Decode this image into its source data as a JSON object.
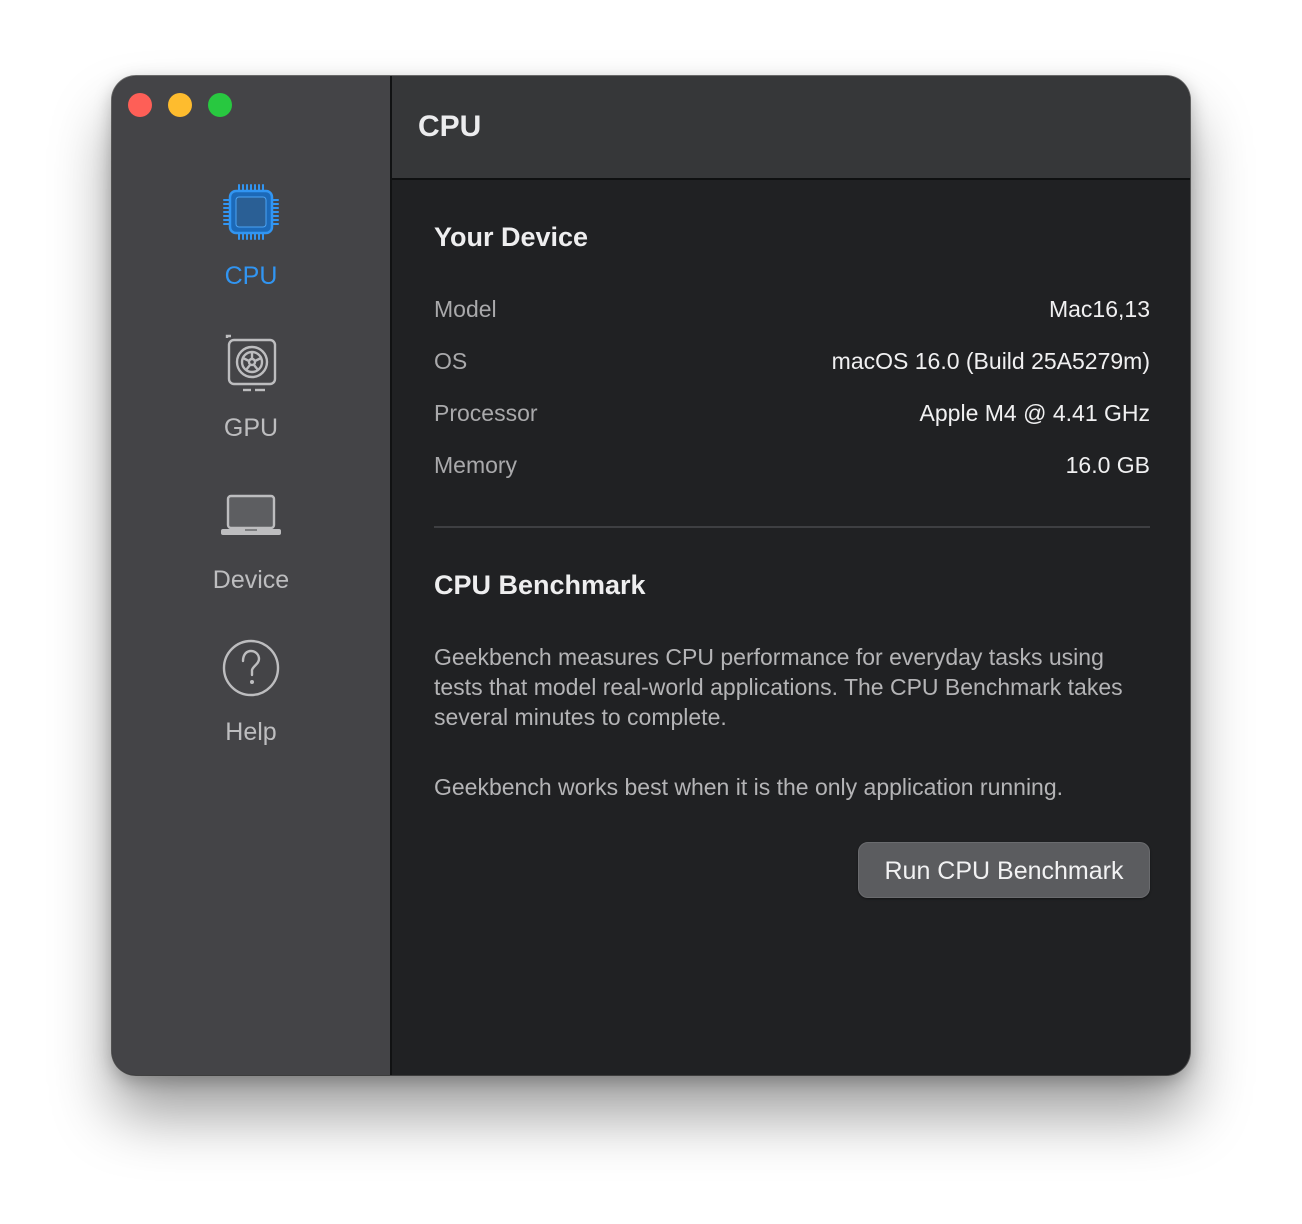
{
  "window": {
    "controls": [
      "close",
      "minimize",
      "maximize"
    ]
  },
  "sidebar": {
    "items": [
      {
        "label": "CPU",
        "icon": "cpu-chip-icon",
        "active": true
      },
      {
        "label": "GPU",
        "icon": "gpu-card-icon",
        "active": false
      },
      {
        "label": "Device",
        "icon": "laptop-icon",
        "active": false
      },
      {
        "label": "Help",
        "icon": "question-mark-icon",
        "active": false
      }
    ],
    "active_color": "#3195f2"
  },
  "header": {
    "title": "CPU"
  },
  "device": {
    "title": "Your Device",
    "rows": [
      {
        "label": "Model",
        "value": "Mac16,13"
      },
      {
        "label": "OS",
        "value": "macOS 16.0 (Build 25A5279m)"
      },
      {
        "label": "Processor",
        "value": "Apple M4 @ 4.41 GHz"
      },
      {
        "label": "Memory",
        "value": "16.0 GB"
      }
    ]
  },
  "benchmark": {
    "title": "CPU Benchmark",
    "description": "Geekbench measures CPU performance for everyday tasks using tests that model real-world applications. The CPU Benchmark takes several minutes to complete.",
    "note": "Geekbench works best when it is the only application running.",
    "button_label": "Run CPU Benchmark"
  }
}
